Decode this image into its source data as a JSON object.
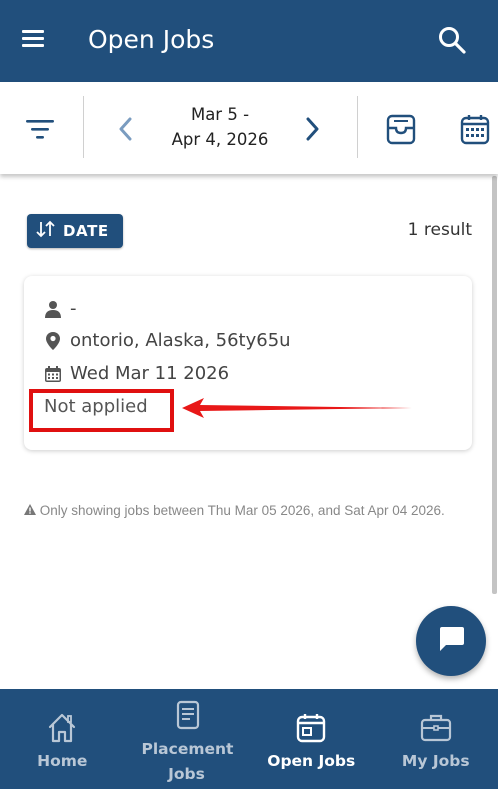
{
  "header": {
    "title": "Open Jobs",
    "menu_icon": "hamburger-menu-icon",
    "search_icon": "search-icon",
    "background": "#214f7c"
  },
  "toolbar": {
    "date_range_line1": "Mar 5 -",
    "date_range_line2": "Apr 4, 2026",
    "filter_icon": "filter-icon",
    "prev_icon": "chevron-left-icon",
    "next_icon": "chevron-right-icon",
    "inbox_icon": "inbox-tray-icon",
    "calendar_icon": "calendar-icon"
  },
  "sort": {
    "label": "DATE",
    "icon": "sort-arrows-icon"
  },
  "results": {
    "count_text": "1 result"
  },
  "jobs": [
    {
      "client": "-",
      "location": "ontorio, Alaska, 56ty65u",
      "date": "Wed Mar 11 2026",
      "status": "Not applied"
    }
  ],
  "notice": {
    "icon": "warning-icon",
    "text": "Only showing jobs between Thu Mar 05 2026, and Sat Apr 04 2026."
  },
  "annotation": {
    "highlight_color": "#e01010"
  },
  "bottom_nav": {
    "items": [
      {
        "label": "Home",
        "icon": "home-icon",
        "active": false
      },
      {
        "label": "Placement Jobs",
        "icon": "document-icon",
        "active": false
      },
      {
        "label": "Open Jobs",
        "icon": "calendar-icon",
        "active": true
      },
      {
        "label": "My Jobs",
        "icon": "briefcase-icon",
        "active": false
      }
    ]
  },
  "chat_fab": {
    "icon": "chat-bubble-icon"
  }
}
